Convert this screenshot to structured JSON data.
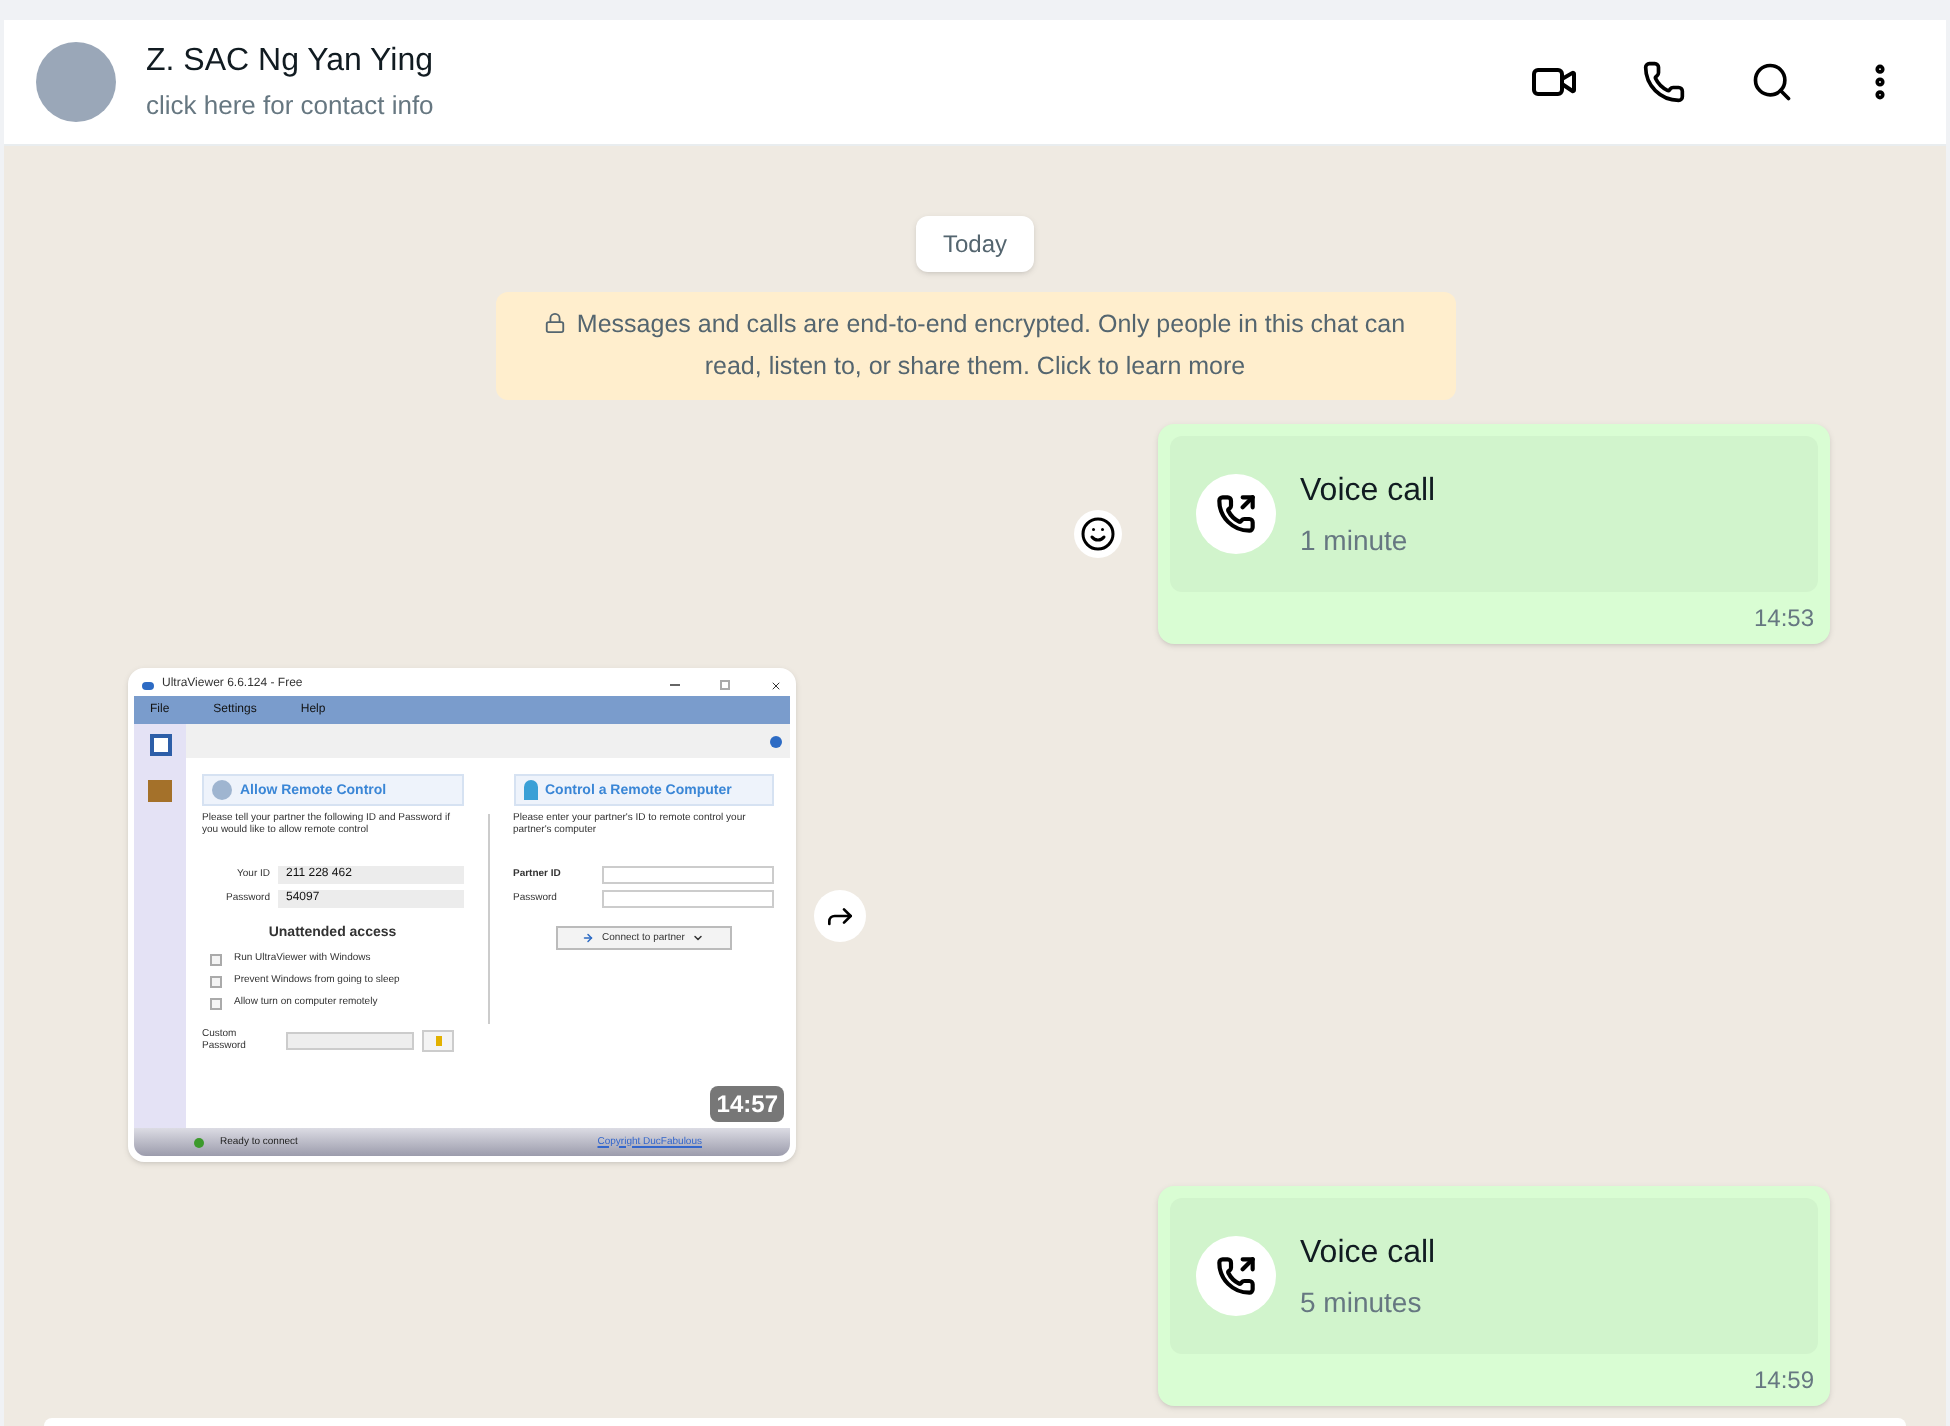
{
  "header": {
    "name": "Z. SAC Ng Yan Ying",
    "subtitle": "click here for contact info"
  },
  "date_chip": "Today",
  "encryption_notice": "Messages and calls are end-to-end encrypted. Only people in this chat can read, listen to, or share them. Click to learn more",
  "messages": [
    {
      "kind": "call",
      "title": "Voice call",
      "duration": "1 minute",
      "time": "14:53"
    },
    {
      "kind": "image",
      "time": "14:57",
      "screenshot": {
        "title": "UltraViewer 6.6.124 - Free",
        "menu": [
          "File",
          "Settings",
          "Help"
        ],
        "allow": {
          "title": "Allow Remote Control",
          "description": "Please tell your partner the following ID and Password if you would like to allow remote control",
          "fields": [
            {
              "label": "Your ID",
              "value": "211 228 462"
            },
            {
              "label": "Password",
              "value": "54097"
            }
          ]
        },
        "unattended": {
          "title": "Unattended access",
          "options": [
            {
              "label": "Run UltraViewer with Windows",
              "checked": false
            },
            {
              "label": "Prevent Windows from going to sleep",
              "checked": false
            },
            {
              "label": "Allow turn on computer remotely",
              "checked": false
            }
          ],
          "custom_password_label": "Custom Password"
        },
        "control": {
          "title": "Control a Remote Computer",
          "description": "Please enter your partner's ID to remote control your partner's computer",
          "fields": [
            {
              "label": "Partner ID"
            },
            {
              "label": "Password"
            }
          ],
          "button": "Connect to partner"
        },
        "status": "Ready to connect",
        "copyright": "Copyright DucFabulous"
      }
    },
    {
      "kind": "call",
      "title": "Voice call",
      "duration": "5 minutes",
      "time": "14:59"
    }
  ]
}
